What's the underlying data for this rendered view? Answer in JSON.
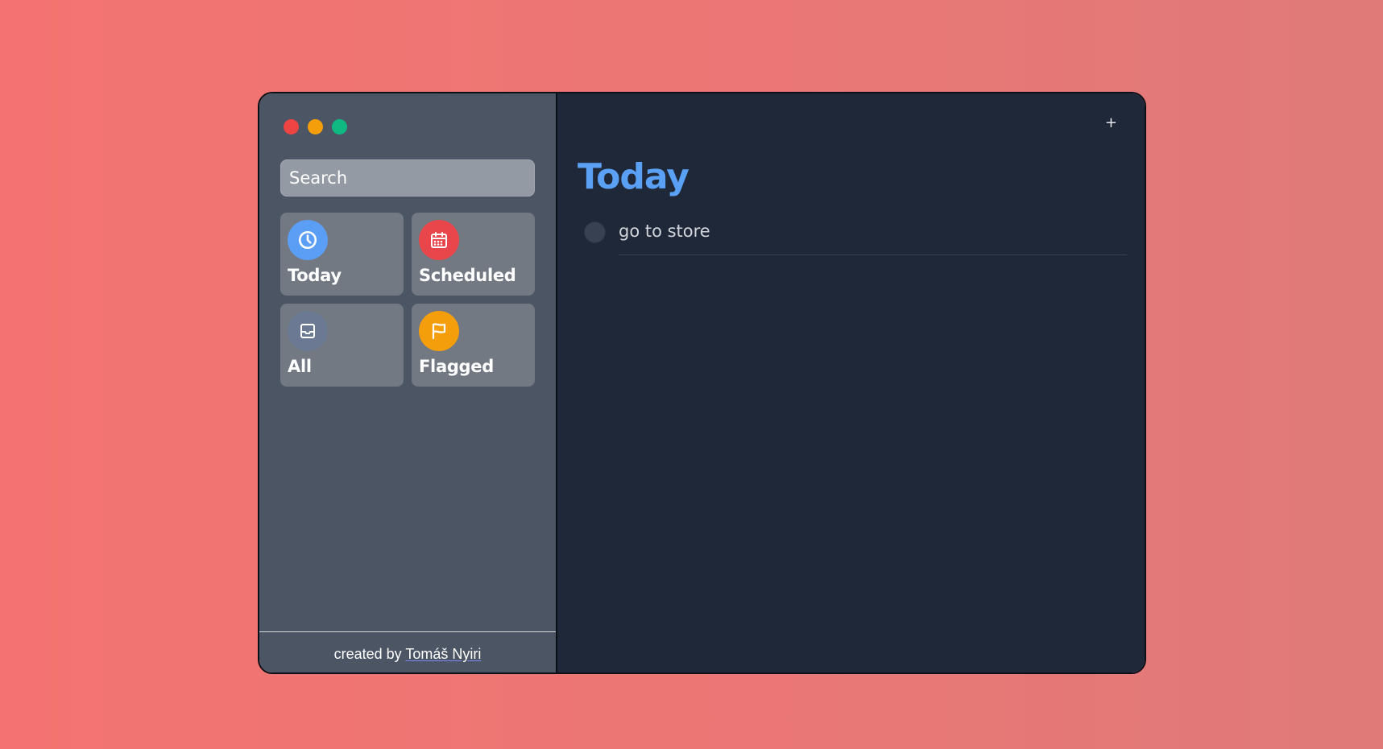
{
  "window_controls": {
    "close_color": "#ef4444",
    "minimize_color": "#f59e0b",
    "maximize_color": "#10b981"
  },
  "sidebar": {
    "search": {
      "placeholder": "Search",
      "value": ""
    },
    "tiles": [
      {
        "label": "Today",
        "icon": "clock-icon",
        "color": "#5b9ef5"
      },
      {
        "label": "Scheduled",
        "icon": "calendar-icon",
        "color": "#e8464b"
      },
      {
        "label": "All",
        "icon": "inbox-icon",
        "color": "#6b7a92"
      },
      {
        "label": "Flagged",
        "icon": "flag-icon",
        "color": "#f59e0b"
      }
    ],
    "footer": {
      "prefix": "created by ",
      "author": "Tomáš Nyiri"
    }
  },
  "main": {
    "add_label": "+",
    "title": "Today",
    "title_color": "#5aa0f5",
    "tasks": [
      {
        "text": "go to store",
        "completed": false
      }
    ]
  }
}
